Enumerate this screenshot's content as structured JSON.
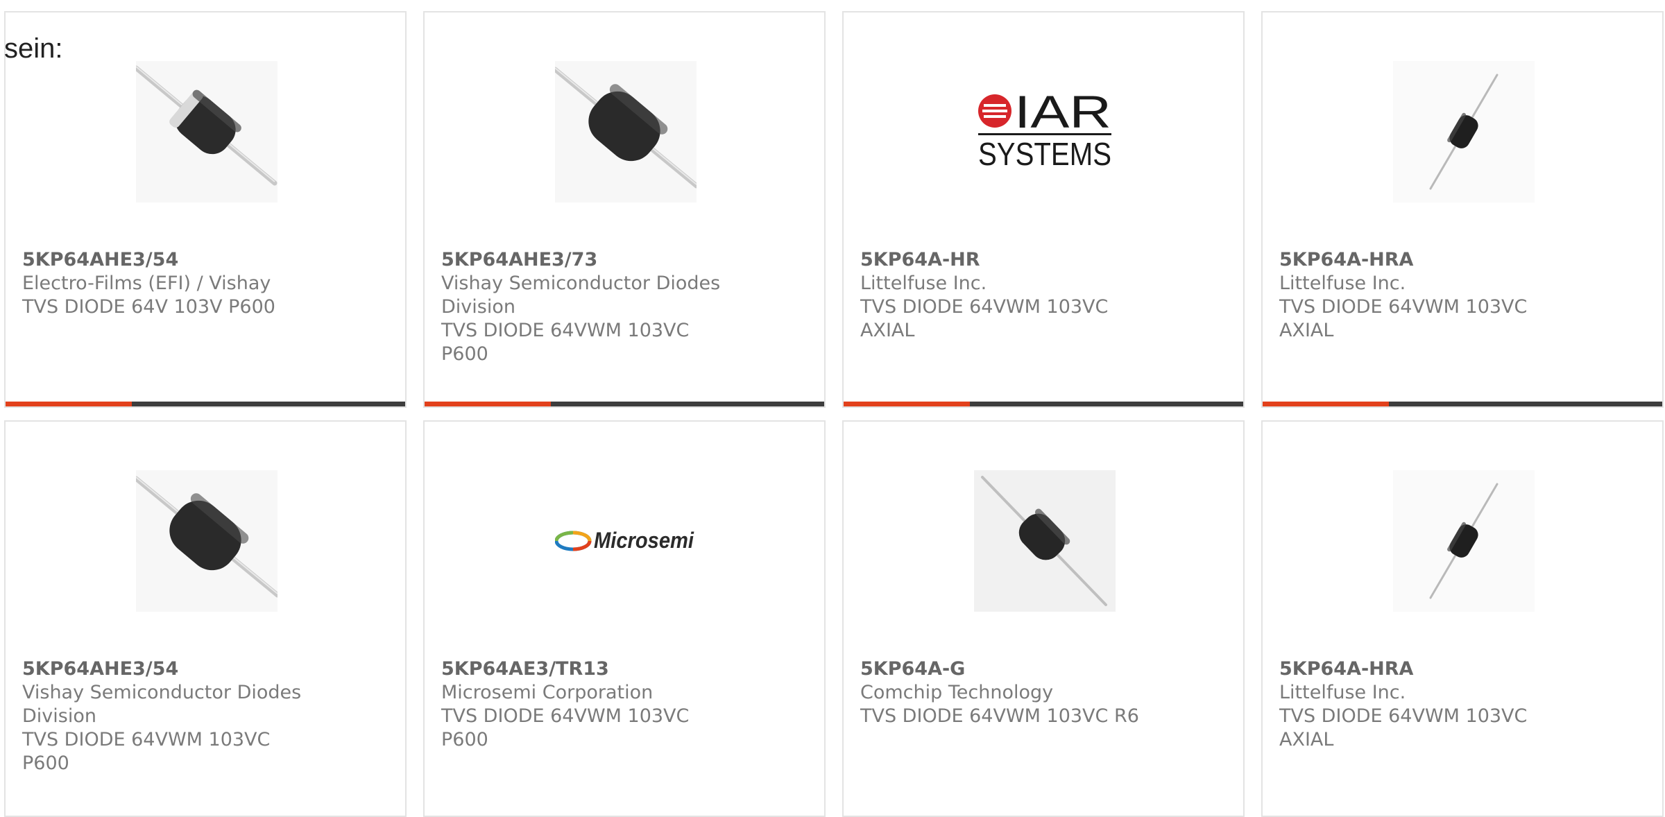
{
  "intro_text": "sein:",
  "colors": {
    "accent": "#e2411c",
    "bar_dark": "#3d3d3d",
    "card_border": "#e3e3e3",
    "text": "#7a7a7a"
  },
  "products": [
    {
      "part_number": "5KP64AHE3/54",
      "manufacturer": "Electro-Films (EFI) / Vishay",
      "description": "TVS DIODE 64V 103V P600",
      "image": "diode-banded-icon"
    },
    {
      "part_number": "5KP64AHE3/73",
      "manufacturer": "Vishay Semiconductor Diodes Division",
      "description": "TVS DIODE 64VWM 103VC P600",
      "image": "diode-large-icon"
    },
    {
      "part_number": "5KP64A-HR",
      "manufacturer": "Littelfuse Inc.",
      "description": "TVS DIODE 64VWM 103VC AXIAL",
      "image": "iar-systems-logo",
      "logo_text": [
        "IAR",
        "SYSTEMS"
      ]
    },
    {
      "part_number": "5KP64A-HRA",
      "manufacturer": "Littelfuse Inc.",
      "description": "TVS DIODE 64VWM 103VC AXIAL",
      "image": "diode-small-axial-icon"
    },
    {
      "part_number": "5KP64AHE3/54",
      "manufacturer": "Vishay Semiconductor Diodes Division",
      "description": "TVS DIODE 64VWM 103VC P600",
      "image": "diode-large-icon"
    },
    {
      "part_number": "5KP64AE3/TR13",
      "manufacturer": "Microsemi Corporation",
      "description": "TVS DIODE 64VWM 103VC P600",
      "image": "microsemi-logo",
      "logo_text": [
        "Microsemi"
      ]
    },
    {
      "part_number": "5KP64A-G",
      "manufacturer": "Comchip Technology",
      "description": "TVS DIODE 64VWM 103VC R6",
      "image": "diode-photo-icon"
    },
    {
      "part_number": "5KP64A-HRA",
      "manufacturer": "Littelfuse Inc.",
      "description": "TVS DIODE 64VWM 103VC AXIAL",
      "image": "diode-small-axial-icon"
    }
  ]
}
